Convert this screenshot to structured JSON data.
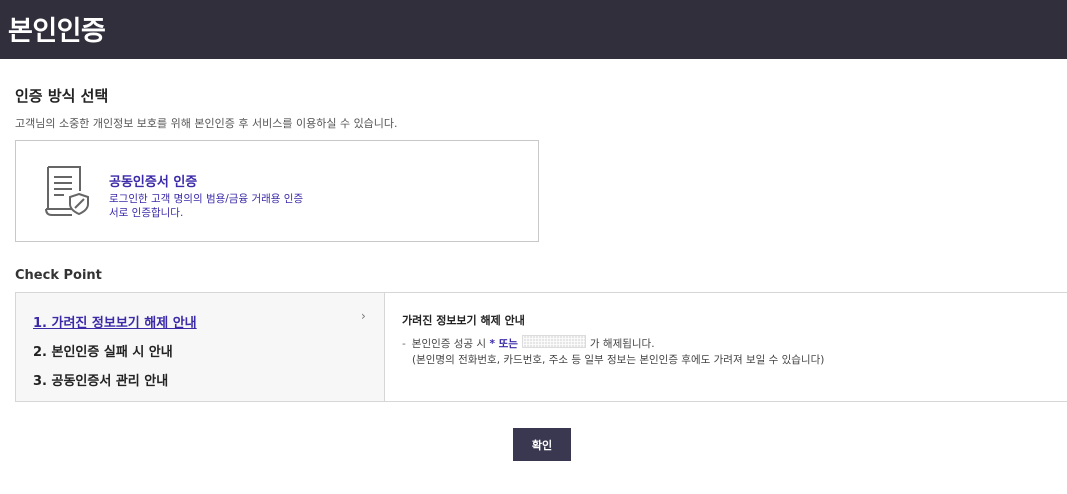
{
  "header": {
    "title": "본인인증"
  },
  "section": {
    "title": "인증 방식 선택",
    "description": "고객님의 소중한 개인정보 보호를 위해 본인인증 후 서비스를 이용하실 수 있습니다."
  },
  "method": {
    "icon": "certificate-icon",
    "title": "공동인증서 인증",
    "description": "로그인한 고객 명의의 범용/금융 거래용 인증서로 인증합니다."
  },
  "checkpoint": {
    "title": "Check Point",
    "items": [
      {
        "label": "1. 가려진 정보보기 해제 안내",
        "active": true
      },
      {
        "label": "2. 본인인증 실패 시 안내",
        "active": false
      },
      {
        "label": "3. 공동인증서 관리 안내",
        "active": false
      }
    ],
    "arrow": "›",
    "detail": {
      "title": "가려진 정보보기 해제 안내",
      "line1_dash": "-",
      "line1_prefix": "본인인증 성공 시",
      "line1_highlight": "* 또는",
      "line1_suffix": "가 해제됩니다.",
      "line2": "(본인명의 전화번호, 카드번호, 주소 등 일부 정보는 본인인증 후에도 가려져 보일 수 있습니다)"
    }
  },
  "footer": {
    "confirm_label": "확인"
  },
  "colors": {
    "header_bg": "#322f3d",
    "accent": "#3a2aa8",
    "button_bg": "#3a3850"
  }
}
